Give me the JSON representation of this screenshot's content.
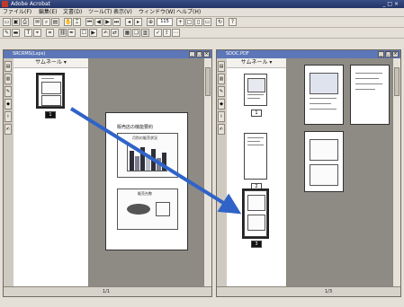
{
  "app": {
    "title": "Adobe Acrobat",
    "window_controls": "_ □ ×",
    "menus": [
      "ファイル(F)",
      "編集(E)",
      "文書(D)",
      "ツール(T)",
      "表示(V)",
      "ウィンドウ(W)",
      "ヘルプ(H)"
    ],
    "zoom_value": "115"
  },
  "left_window": {
    "title": "SRCRMS(Lxps)",
    "thumbnails_header": "サムネール",
    "page_label": "1",
    "page_counter": "1/1",
    "doc_title": "販売店の機能要約",
    "chart1_title": "月別の販売状況",
    "chart2_title": "販売台数"
  },
  "right_window": {
    "title": "SDOC.PDF",
    "thumbnails_header": "サムネール",
    "page_labels": [
      "1",
      "2",
      "3"
    ],
    "page_counter": "1/3"
  },
  "colors": {
    "title_bar": "#223366",
    "doc_window_bar": "#5c76b8",
    "arrow": "#2f63c7",
    "gray_area": "#8e8a84",
    "bar_dark": "#2f2f3a",
    "bar_mid": "#7a7e8f",
    "bar_light": "#b9bdc9"
  },
  "icons": {
    "app": "acrobat-icon",
    "drag_arrow": "arrow-icon"
  }
}
